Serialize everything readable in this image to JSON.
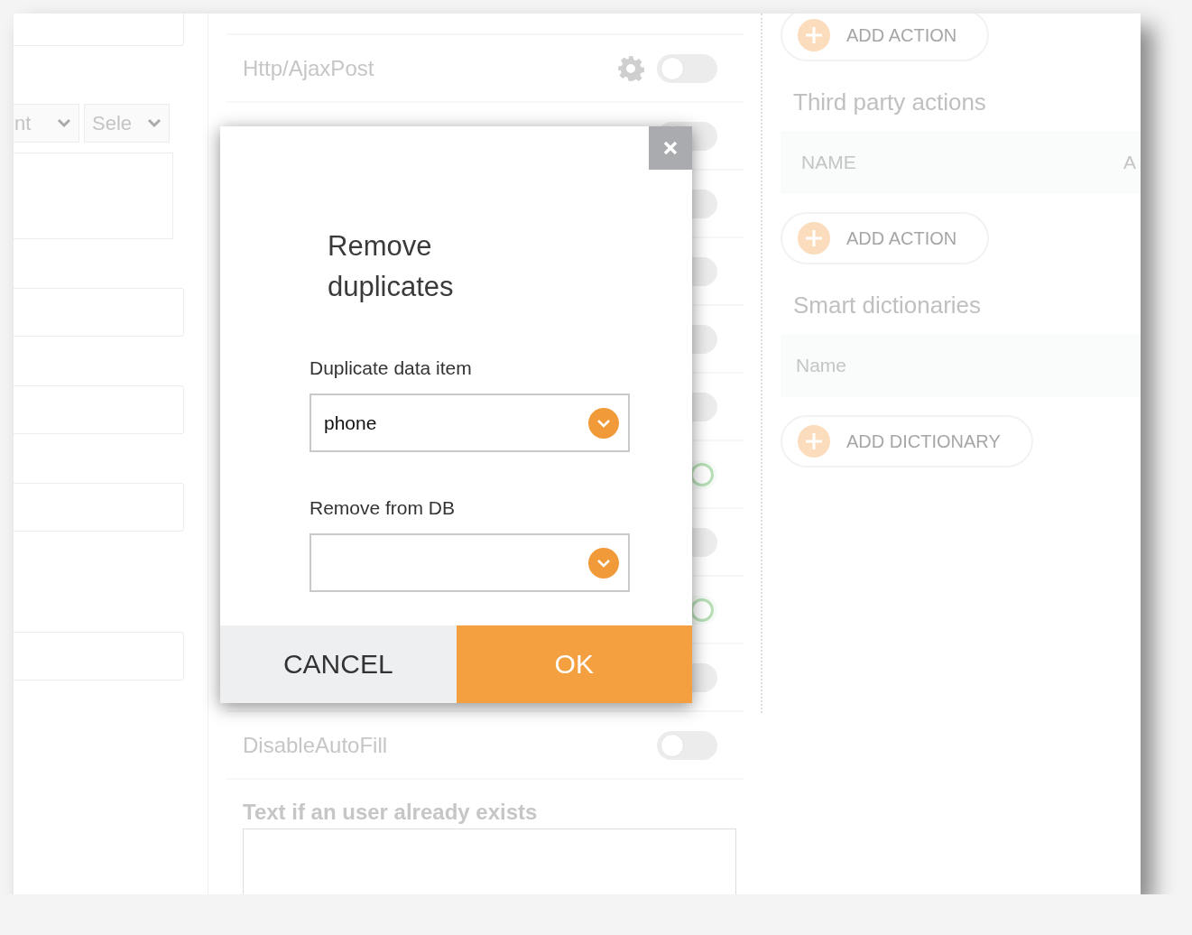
{
  "left_panel": {
    "fields": [
      {
        "kind": "input"
      },
      {
        "kind": "select_pair",
        "selects": [
          {
            "value": "nt"
          },
          {
            "value": "Sele"
          }
        ]
      },
      {
        "kind": "textarea"
      },
      {
        "kind": "input"
      },
      {
        "kind": "input"
      },
      {
        "kind": "input"
      },
      {
        "kind": "input"
      }
    ]
  },
  "settings": {
    "rows": [
      {
        "kind": "with_settings",
        "label": "Http/AjaxPost",
        "on": false
      },
      {
        "kind": "plain",
        "on": false
      },
      {
        "kind": "plain",
        "on": false
      },
      {
        "kind": "plain",
        "on": false
      },
      {
        "kind": "plain",
        "on": false
      },
      {
        "kind": "plain",
        "on": false
      },
      {
        "kind": "plain",
        "on": true
      },
      {
        "kind": "plain",
        "on": false
      },
      {
        "kind": "plain",
        "on": true
      },
      {
        "kind": "plain",
        "on": false
      },
      {
        "kind": "plain",
        "label": "DisableAutoFill",
        "on": false
      }
    ],
    "message_field": {
      "label": "Text if an user already exists"
    }
  },
  "right_panel": {
    "sections": [
      {
        "kind": "button",
        "label": "ADD ACTION"
      },
      {
        "kind": "heading",
        "text": "Third party actions"
      },
      {
        "kind": "table_header",
        "columns": [
          "NAME",
          "A"
        ]
      },
      {
        "kind": "button",
        "label": "ADD ACTION"
      },
      {
        "kind": "heading",
        "text": "Smart dictionaries"
      },
      {
        "kind": "table_header",
        "columns": [
          "Name"
        ]
      },
      {
        "kind": "button",
        "label": "ADD DICTIONARY"
      }
    ]
  },
  "dialog": {
    "title": "Remove duplicates",
    "fields": [
      {
        "label": "Duplicate data item",
        "value": "phone"
      },
      {
        "label": "Remove from DB"
      }
    ],
    "buttons": [
      {
        "kind": "cancel",
        "label": "CANCEL"
      },
      {
        "kind": "confirm",
        "label": "OK"
      }
    ]
  }
}
